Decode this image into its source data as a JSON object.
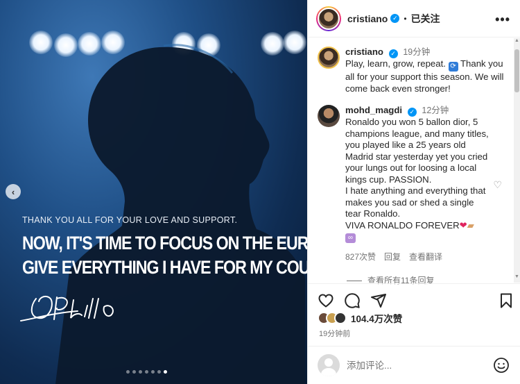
{
  "post": {
    "caption_small": "THANK YOU ALL FOR YOUR LOVE AND SUPPORT.",
    "caption_line1": "NOW, IT'S TIME TO FOCUS ON THE EURO AND",
    "caption_line2": "GIVE EVERYTHING I HAVE FOR MY COUNTRY.",
    "carousel_dots": 7,
    "carousel_active_index": 6
  },
  "header": {
    "username": "cristiano",
    "verified_icon": "verified-badge-icon",
    "separator": "•",
    "follow_status": "已关注",
    "more_label": "•••"
  },
  "comments": [
    {
      "user": "cristiano",
      "time": "19分钟",
      "text_before_emoji": "Play, learn, grow, repeat. ",
      "text_after_emoji": " Thank you all for your support this season. We will come back even stronger!"
    },
    {
      "user": "mohd_magdi",
      "time": "12分钟",
      "text": "Ronaldo you won 5 ballon dior, 5 champions league, and many titles, you played like a 25 years old Madrid star yesterday yet you cried your lungs out for loosing a local kings cup. PASSION.\nI hate anything and everything that makes you sad or shed a single tear Ronaldo.\nVIVA RONALDO FOREVER",
      "likes": "827次赞",
      "reply": "回复",
      "translate": "查看翻译"
    }
  ],
  "view_replies": "查看所有11条回复",
  "likes_count": "104.4万次赞",
  "posted_time": "19分钟前",
  "comment_placeholder": "添加评论...",
  "colors": {
    "verified": "#0095f6",
    "heart": "#e0245e",
    "photo_bg": "#1f4f86"
  }
}
